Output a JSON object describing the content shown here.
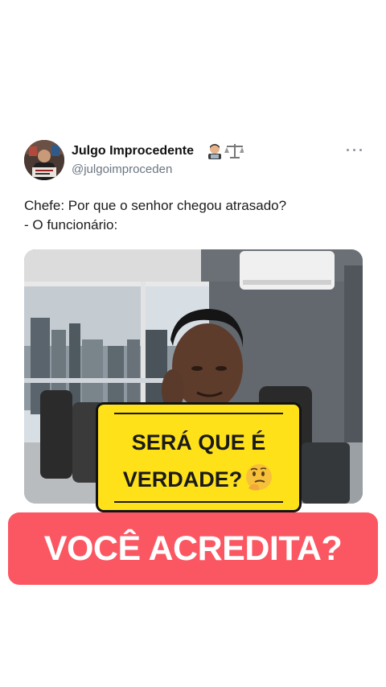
{
  "tweet": {
    "display_name": "Julgo Improcedente",
    "name_emoji_icons": [
      "man-technologist-icon",
      "balance-scale-icon"
    ],
    "handle": "@julgoimproceden",
    "more_icon": "more-dots-icon",
    "text_lines": [
      "Chefe: Por que o senhor chegou atrasado?",
      "- O funcionário:"
    ]
  },
  "caption": {
    "line1": "SERÁ QUE É",
    "line2": "VERDADE?",
    "emoji_icon": "thinking-face-icon",
    "background": "#ffe11a"
  },
  "banner": {
    "text": "VOCÊ ACREDITA?",
    "background": "#fb5762"
  }
}
